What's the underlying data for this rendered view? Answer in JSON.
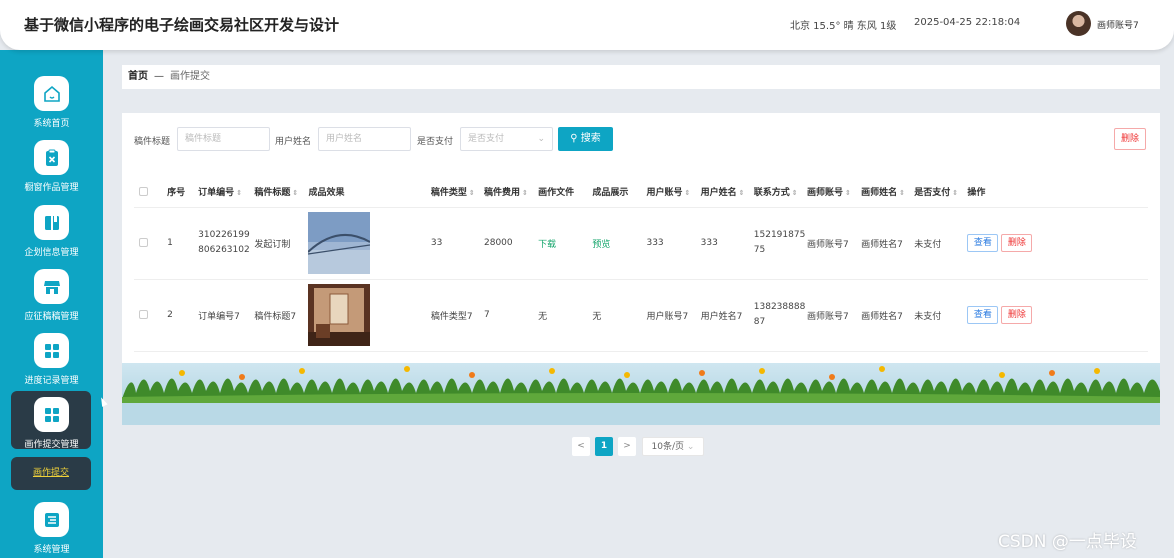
{
  "header": {
    "title": "基于微信小程序的电子绘画交易社区开发与设计",
    "weather": "北京  15.5°  晴  东风  1级",
    "datetime": "2025-04-25 22:18:04",
    "user": "画师账号7"
  },
  "sidebar": {
    "items": [
      {
        "label": "系统首页",
        "icon": "home-icon"
      },
      {
        "label": "橱窗作品管理",
        "icon": "clipboard-icon"
      },
      {
        "label": "企划信息管理",
        "icon": "book-icon"
      },
      {
        "label": "应征稿稿管理",
        "icon": "store-icon"
      },
      {
        "label": "进度记录管理",
        "icon": "grid-icon"
      },
      {
        "label": "画作提交管理",
        "icon": "grid-icon"
      },
      {
        "label": "系统管理",
        "icon": "list-icon"
      }
    ],
    "active_sub": "画作提交"
  },
  "breadcrumb": {
    "home": "首页",
    "separator": "—",
    "current": "画作提交"
  },
  "filters": {
    "title_label": "稿件标题",
    "title_placeholder": "稿件标题",
    "user_label": "用户姓名",
    "user_placeholder": "用户姓名",
    "paid_label": "是否支付",
    "paid_placeholder": "是否支付",
    "search": "搜索",
    "delete": "删除"
  },
  "table": {
    "headers": [
      "序号",
      "订单编号",
      "稿件标题",
      "成品效果",
      "稿件类型",
      "稿件费用",
      "画作文件",
      "成品展示",
      "用户账号",
      "用户姓名",
      "联系方式",
      "画师账号",
      "画师姓名",
      "是否支付",
      "操作"
    ],
    "rows": [
      {
        "index": "1",
        "order": "310226199806263102",
        "title": "发起订制",
        "type": "33",
        "fee": "28000",
        "file": "下载",
        "preview": "预览",
        "account": "333",
        "name": "333",
        "contact": "15219187575",
        "artist_account": "画师账号7",
        "artist_name": "画师姓名7",
        "paid": "未支付",
        "view": "查看",
        "delete": "删除"
      },
      {
        "index": "2",
        "order": "订单编号7",
        "title": "稿件标题7",
        "type": "稿件类型7",
        "fee": "7",
        "file": "无",
        "preview": "无",
        "account": "用户账号7",
        "name": "用户姓名7",
        "contact": "13823888887",
        "artist_account": "画师账号7",
        "artist_name": "画师姓名7",
        "paid": "未支付",
        "view": "查看",
        "delete": "删除"
      }
    ]
  },
  "pagination": {
    "prev": "<",
    "current": "1",
    "next": ">",
    "page_size": "10条/页"
  },
  "watermark": "CSDN @一点毕设"
}
